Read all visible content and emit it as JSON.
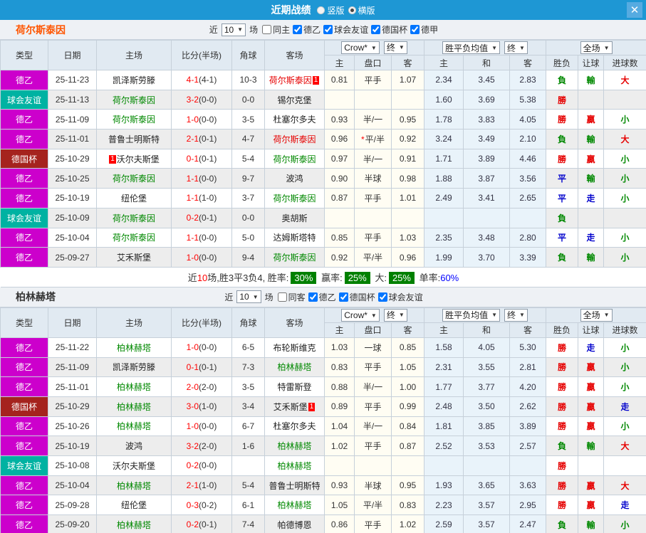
{
  "titlebar": {
    "title": "近期战绩",
    "radio_options": [
      {
        "label": "竖版",
        "selected": false
      },
      {
        "label": "横版",
        "selected": true
      }
    ],
    "close_label": "✕"
  },
  "table_header": {
    "left_columns": [
      "类型",
      "日期",
      "主场",
      "比分(半场)",
      "角球",
      "客场"
    ],
    "odds_sub": [
      "主",
      "盘口",
      "客"
    ],
    "euro_sub": [
      "主",
      "和",
      "客"
    ],
    "result_sub": [
      "胜负",
      "让球",
      "进球数"
    ],
    "bookmaker_select": "Crow*",
    "final_select": "终",
    "avg_select": "胜平负均值",
    "final_select2": "终",
    "scope_select": "全场"
  },
  "colors": {
    "topbar": "#1e97d4",
    "league_de2": "#cc00cc",
    "league_friendly": "#00b2a2",
    "league_cup": "#a5231e",
    "chip_bg": "#008000"
  },
  "sections": [
    {
      "team": "荷尔斯泰因",
      "team_color": "#ff5500",
      "filter": {
        "near": "近",
        "count": "10",
        "games": "场"
      },
      "checkboxes": [
        {
          "label": "同主",
          "checked": false
        },
        {
          "label": "德乙",
          "checked": true
        },
        {
          "label": "球会友谊",
          "checked": true
        },
        {
          "label": "德国杯",
          "checked": true
        },
        {
          "label": "德甲",
          "checked": true
        }
      ],
      "rows": [
        {
          "type": "德乙",
          "type_bg": "#cc00cc",
          "date": "25-11-23",
          "home": "凯泽斯劳滕",
          "home_color": "black",
          "home_badge": "",
          "score": "4-1",
          "half": "(4-1)",
          "corner": "10-3",
          "away": "荷尔斯泰因",
          "away_color": "red",
          "away_badge": "1",
          "odds": [
            "0.81",
            "平手",
            "1.07"
          ],
          "odds_star": false,
          "euro": [
            "2.34",
            "3.45",
            "2.83"
          ],
          "results": [
            {
              "text": "負",
              "color": "green"
            },
            {
              "text": "輸",
              "color": "green"
            },
            {
              "text": "大",
              "color": "red"
            }
          ]
        },
        {
          "type": "球会友谊",
          "type_bg": "#00b2a2",
          "date": "25-11-13",
          "home": "荷尔斯泰因",
          "home_color": "green",
          "home_badge": "",
          "score": "3-2",
          "half": "(0-0)",
          "corner": "0-0",
          "away": "锡尔克堡",
          "away_color": "black",
          "away_badge": "",
          "odds": [
            "",
            "",
            ""
          ],
          "odds_star": false,
          "euro": [
            "1.60",
            "3.69",
            "5.38"
          ],
          "results": [
            {
              "text": "勝",
              "color": "red"
            },
            {
              "text": "",
              "color": "black"
            },
            {
              "text": "",
              "color": "black"
            }
          ]
        },
        {
          "type": "德乙",
          "type_bg": "#cc00cc",
          "date": "25-11-09",
          "home": "荷尔斯泰因",
          "home_color": "green",
          "home_badge": "",
          "score": "1-0",
          "half": "(0-0)",
          "corner": "3-5",
          "away": "杜塞尔多夫",
          "away_color": "black",
          "away_badge": "",
          "odds": [
            "0.93",
            "半/一",
            "0.95"
          ],
          "odds_star": false,
          "euro": [
            "1.78",
            "3.83",
            "4.05"
          ],
          "results": [
            {
              "text": "勝",
              "color": "red"
            },
            {
              "text": "贏",
              "color": "red"
            },
            {
              "text": "小",
              "color": "green"
            }
          ]
        },
        {
          "type": "德乙",
          "type_bg": "#cc00cc",
          "date": "25-11-01",
          "home": "普鲁士明斯特",
          "home_color": "black",
          "home_badge": "",
          "score": "2-1",
          "half": "(0-1)",
          "corner": "4-7",
          "away": "荷尔斯泰因",
          "away_color": "red",
          "away_badge": "",
          "odds": [
            "0.96",
            "平/半",
            "0.92"
          ],
          "odds_star": true,
          "euro": [
            "3.24",
            "3.49",
            "2.10"
          ],
          "results": [
            {
              "text": "負",
              "color": "green"
            },
            {
              "text": "輸",
              "color": "green"
            },
            {
              "text": "大",
              "color": "red"
            }
          ]
        },
        {
          "type": "德国杯",
          "type_bg": "#a5231e",
          "date": "25-10-29",
          "home": "沃尔夫斯堡",
          "home_color": "black",
          "home_badge": "1",
          "score": "0-1",
          "half": "(0-1)",
          "corner": "5-4",
          "away": "荷尔斯泰因",
          "away_color": "green",
          "away_badge": "",
          "odds": [
            "0.97",
            "半/一",
            "0.91"
          ],
          "odds_star": false,
          "euro": [
            "1.71",
            "3.89",
            "4.46"
          ],
          "results": [
            {
              "text": "勝",
              "color": "red"
            },
            {
              "text": "贏",
              "color": "red"
            },
            {
              "text": "小",
              "color": "green"
            }
          ]
        },
        {
          "type": "德乙",
          "type_bg": "#cc00cc",
          "date": "25-10-25",
          "home": "荷尔斯泰因",
          "home_color": "green",
          "home_badge": "",
          "score": "1-1",
          "half": "(0-0)",
          "corner": "9-7",
          "away": "波鸿",
          "away_color": "black",
          "away_badge": "",
          "odds": [
            "0.90",
            "半球",
            "0.98"
          ],
          "odds_star": false,
          "euro": [
            "1.88",
            "3.87",
            "3.56"
          ],
          "results": [
            {
              "text": "平",
              "color": "blue"
            },
            {
              "text": "輸",
              "color": "green"
            },
            {
              "text": "小",
              "color": "green"
            }
          ]
        },
        {
          "type": "德乙",
          "type_bg": "#cc00cc",
          "date": "25-10-19",
          "home": "纽伦堡",
          "home_color": "black",
          "home_badge": "",
          "score": "1-1",
          "half": "(1-0)",
          "corner": "3-7",
          "away": "荷尔斯泰因",
          "away_color": "green",
          "away_badge": "",
          "odds": [
            "0.87",
            "平手",
            "1.01"
          ],
          "odds_star": false,
          "euro": [
            "2.49",
            "3.41",
            "2.65"
          ],
          "results": [
            {
              "text": "平",
              "color": "blue"
            },
            {
              "text": "走",
              "color": "blue"
            },
            {
              "text": "小",
              "color": "green"
            }
          ]
        },
        {
          "type": "球会友谊",
          "type_bg": "#00b2a2",
          "date": "25-10-09",
          "home": "荷尔斯泰因",
          "home_color": "green",
          "home_badge": "",
          "score": "0-2",
          "half": "(0-1)",
          "corner": "0-0",
          "away": "奥胡斯",
          "away_color": "black",
          "away_badge": "",
          "odds": [
            "",
            "",
            ""
          ],
          "odds_star": false,
          "euro": [
            "",
            "",
            ""
          ],
          "results": [
            {
              "text": "負",
              "color": "green"
            },
            {
              "text": "",
              "color": "black"
            },
            {
              "text": "",
              "color": "black"
            }
          ]
        },
        {
          "type": "德乙",
          "type_bg": "#cc00cc",
          "date": "25-10-04",
          "home": "荷尔斯泰因",
          "home_color": "green",
          "home_badge": "",
          "score": "1-1",
          "half": "(0-0)",
          "corner": "5-0",
          "away": "达姆斯塔特",
          "away_color": "black",
          "away_badge": "",
          "odds": [
            "0.85",
            "平手",
            "1.03"
          ],
          "odds_star": false,
          "euro": [
            "2.35",
            "3.48",
            "2.80"
          ],
          "results": [
            {
              "text": "平",
              "color": "blue"
            },
            {
              "text": "走",
              "color": "blue"
            },
            {
              "text": "小",
              "color": "green"
            }
          ]
        },
        {
          "type": "德乙",
          "type_bg": "#cc00cc",
          "date": "25-09-27",
          "home": "艾禾斯堡",
          "home_color": "black",
          "home_badge": "",
          "score": "1-0",
          "half": "(0-0)",
          "corner": "9-4",
          "away": "荷尔斯泰因",
          "away_color": "green",
          "away_badge": "",
          "odds": [
            "0.92",
            "平/半",
            "0.96"
          ],
          "odds_star": false,
          "euro": [
            "1.99",
            "3.70",
            "3.39"
          ],
          "results": [
            {
              "text": "負",
              "color": "green"
            },
            {
              "text": "輸",
              "color": "green"
            },
            {
              "text": "小",
              "color": "green"
            }
          ]
        }
      ],
      "summary": {
        "near": "近",
        "count": "10",
        "mid": "场,胜3平3负4, 胜率:",
        "chip1": "30%",
        "label2": "赢率:",
        "chip2": "25%",
        "label3": "大:",
        "chip3": "25%",
        "label4": "单率:",
        "single": "60%"
      }
    },
    {
      "team": "柏林赫塔",
      "team_color": "#333333",
      "filter": {
        "near": "近",
        "count": "10",
        "games": "场"
      },
      "checkboxes": [
        {
          "label": "同客",
          "checked": false
        },
        {
          "label": "德乙",
          "checked": true
        },
        {
          "label": "德国杯",
          "checked": true
        },
        {
          "label": "球会友谊",
          "checked": true
        }
      ],
      "rows": [
        {
          "type": "德乙",
          "type_bg": "#cc00cc",
          "date": "25-11-22",
          "home": "柏林赫塔",
          "home_color": "green",
          "home_badge": "",
          "score": "1-0",
          "half": "(0-0)",
          "corner": "6-5",
          "away": "布轮斯维克",
          "away_color": "black",
          "away_badge": "",
          "odds": [
            "1.03",
            "一球",
            "0.85"
          ],
          "odds_star": false,
          "euro": [
            "1.58",
            "4.05",
            "5.30"
          ],
          "results": [
            {
              "text": "勝",
              "color": "red"
            },
            {
              "text": "走",
              "color": "blue"
            },
            {
              "text": "小",
              "color": "green"
            }
          ]
        },
        {
          "type": "德乙",
          "type_bg": "#cc00cc",
          "date": "25-11-09",
          "home": "凯泽斯劳滕",
          "home_color": "black",
          "home_badge": "",
          "score": "0-1",
          "half": "(0-1)",
          "corner": "7-3",
          "away": "柏林赫塔",
          "away_color": "green",
          "away_badge": "",
          "odds": [
            "0.83",
            "平手",
            "1.05"
          ],
          "odds_star": false,
          "euro": [
            "2.31",
            "3.55",
            "2.81"
          ],
          "results": [
            {
              "text": "勝",
              "color": "red"
            },
            {
              "text": "贏",
              "color": "red"
            },
            {
              "text": "小",
              "color": "green"
            }
          ]
        },
        {
          "type": "德乙",
          "type_bg": "#cc00cc",
          "date": "25-11-01",
          "home": "柏林赫塔",
          "home_color": "green",
          "home_badge": "",
          "score": "2-0",
          "half": "(2-0)",
          "corner": "3-5",
          "away": "特雷斯登",
          "away_color": "black",
          "away_badge": "",
          "odds": [
            "0.88",
            "半/一",
            "1.00"
          ],
          "odds_star": false,
          "euro": [
            "1.77",
            "3.77",
            "4.20"
          ],
          "results": [
            {
              "text": "勝",
              "color": "red"
            },
            {
              "text": "贏",
              "color": "red"
            },
            {
              "text": "小",
              "color": "green"
            }
          ]
        },
        {
          "type": "德国杯",
          "type_bg": "#a5231e",
          "date": "25-10-29",
          "home": "柏林赫塔",
          "home_color": "green",
          "home_badge": "",
          "score": "3-0",
          "half": "(1-0)",
          "corner": "3-4",
          "away": "艾禾斯堡",
          "away_color": "black",
          "away_badge": "1",
          "odds": [
            "0.89",
            "平手",
            "0.99"
          ],
          "odds_star": false,
          "euro": [
            "2.48",
            "3.50",
            "2.62"
          ],
          "results": [
            {
              "text": "勝",
              "color": "red"
            },
            {
              "text": "贏",
              "color": "red"
            },
            {
              "text": "走",
              "color": "blue"
            }
          ]
        },
        {
          "type": "德乙",
          "type_bg": "#cc00cc",
          "date": "25-10-26",
          "home": "柏林赫塔",
          "home_color": "green",
          "home_badge": "",
          "score": "1-0",
          "half": "(0-0)",
          "corner": "6-7",
          "away": "杜塞尔多夫",
          "away_color": "black",
          "away_badge": "",
          "odds": [
            "1.04",
            "半/一",
            "0.84"
          ],
          "odds_star": false,
          "euro": [
            "1.81",
            "3.85",
            "3.89"
          ],
          "results": [
            {
              "text": "勝",
              "color": "red"
            },
            {
              "text": "贏",
              "color": "red"
            },
            {
              "text": "小",
              "color": "green"
            }
          ]
        },
        {
          "type": "德乙",
          "type_bg": "#cc00cc",
          "date": "25-10-19",
          "home": "波鸿",
          "home_color": "black",
          "home_badge": "",
          "score": "3-2",
          "half": "(2-0)",
          "corner": "1-6",
          "away": "柏林赫塔",
          "away_color": "green",
          "away_badge": "",
          "odds": [
            "1.02",
            "平手",
            "0.87"
          ],
          "odds_star": false,
          "euro": [
            "2.52",
            "3.53",
            "2.57"
          ],
          "results": [
            {
              "text": "負",
              "color": "green"
            },
            {
              "text": "輸",
              "color": "green"
            },
            {
              "text": "大",
              "color": "red"
            }
          ]
        },
        {
          "type": "球会友谊",
          "type_bg": "#00b2a2",
          "date": "25-10-08",
          "home": "沃尔夫斯堡",
          "home_color": "black",
          "home_badge": "",
          "score": "0-2",
          "half": "(0-0)",
          "corner": "",
          "away": "柏林赫塔",
          "away_color": "green",
          "away_badge": "",
          "odds": [
            "",
            "",
            ""
          ],
          "odds_star": false,
          "euro": [
            "",
            "",
            ""
          ],
          "results": [
            {
              "text": "勝",
              "color": "red"
            },
            {
              "text": "",
              "color": "black"
            },
            {
              "text": "",
              "color": "black"
            }
          ]
        },
        {
          "type": "德乙",
          "type_bg": "#cc00cc",
          "date": "25-10-04",
          "home": "柏林赫塔",
          "home_color": "green",
          "home_badge": "",
          "score": "2-1",
          "half": "(1-0)",
          "corner": "5-4",
          "away": "普鲁士明斯特",
          "away_color": "black",
          "away_badge": "",
          "odds": [
            "0.93",
            "半球",
            "0.95"
          ],
          "odds_star": false,
          "euro": [
            "1.93",
            "3.65",
            "3.63"
          ],
          "results": [
            {
              "text": "勝",
              "color": "red"
            },
            {
              "text": "贏",
              "color": "red"
            },
            {
              "text": "大",
              "color": "red"
            }
          ]
        },
        {
          "type": "德乙",
          "type_bg": "#cc00cc",
          "date": "25-09-28",
          "home": "纽伦堡",
          "home_color": "black",
          "home_badge": "",
          "score": "0-3",
          "half": "(0-2)",
          "corner": "6-1",
          "away": "柏林赫塔",
          "away_color": "green",
          "away_badge": "",
          "odds": [
            "1.05",
            "平/半",
            "0.83"
          ],
          "odds_star": false,
          "euro": [
            "2.23",
            "3.57",
            "2.95"
          ],
          "results": [
            {
              "text": "勝",
              "color": "red"
            },
            {
              "text": "贏",
              "color": "red"
            },
            {
              "text": "走",
              "color": "blue"
            }
          ]
        },
        {
          "type": "德乙",
          "type_bg": "#cc00cc",
          "date": "25-09-20",
          "home": "柏林赫塔",
          "home_color": "green",
          "home_badge": "",
          "score": "0-2",
          "half": "(0-1)",
          "corner": "7-4",
          "away": "帕德博恩",
          "away_color": "black",
          "away_badge": "",
          "odds": [
            "0.86",
            "平手",
            "1.02"
          ],
          "odds_star": false,
          "euro": [
            "2.59",
            "3.57",
            "2.47"
          ],
          "results": [
            {
              "text": "負",
              "color": "green"
            },
            {
              "text": "輸",
              "color": "green"
            },
            {
              "text": "小",
              "color": "green"
            }
          ]
        }
      ],
      "summary": null
    }
  ]
}
